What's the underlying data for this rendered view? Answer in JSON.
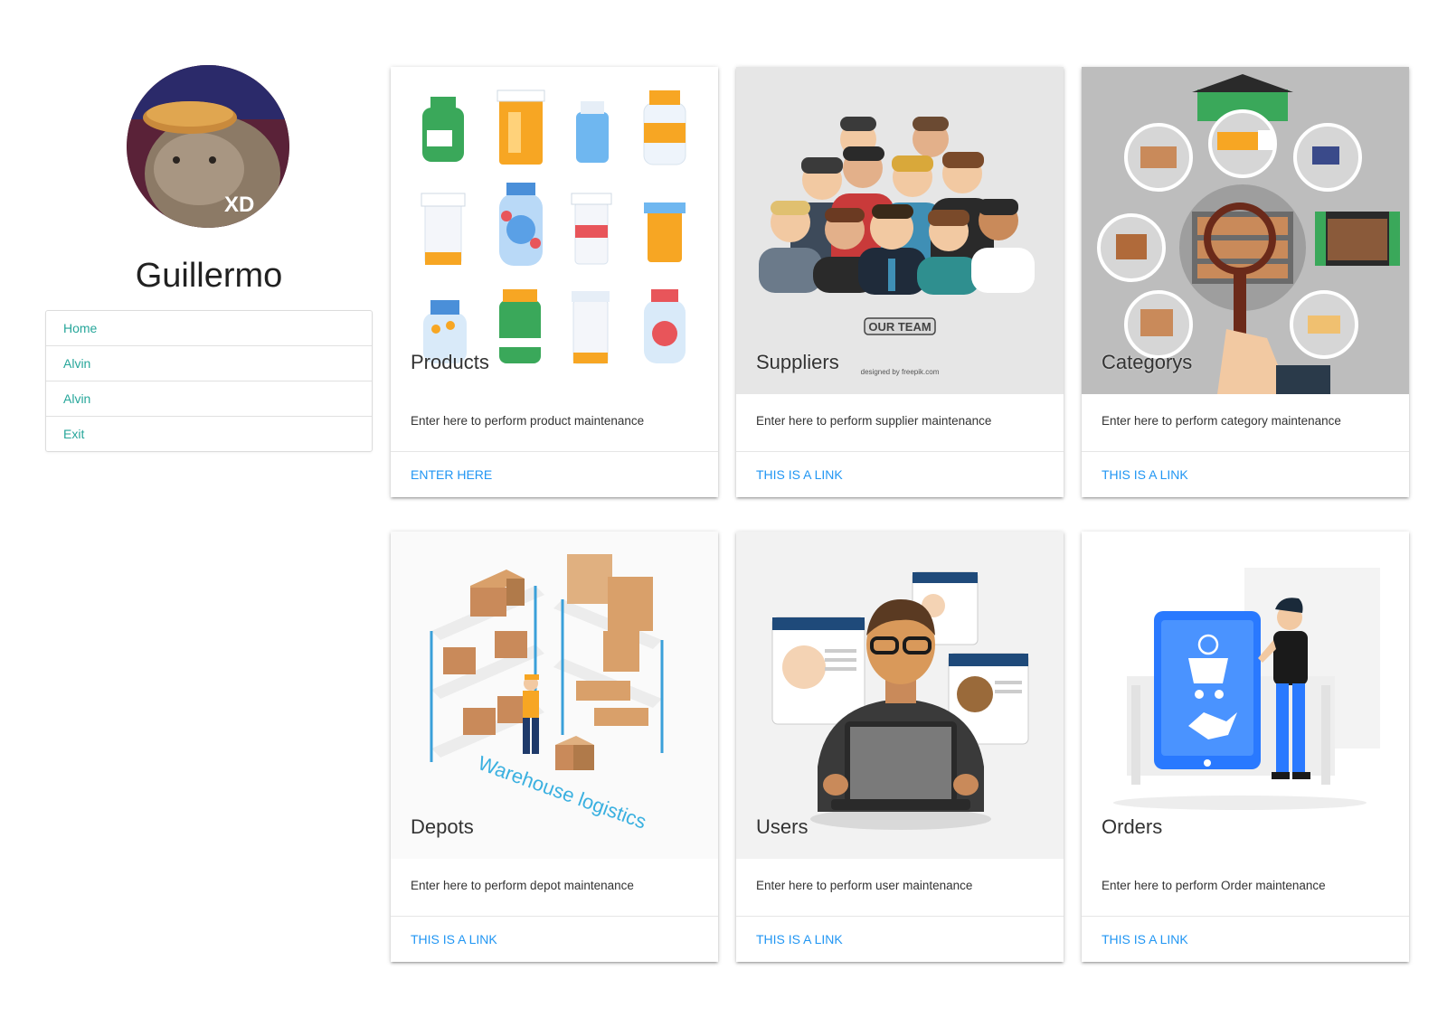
{
  "profile": {
    "name": "Guillermo",
    "avatar_badge": "XD"
  },
  "menu": {
    "items": [
      {
        "label": "Home"
      },
      {
        "label": "Alvin"
      },
      {
        "label": "Alvin"
      },
      {
        "label": "Exit"
      }
    ]
  },
  "cards": [
    {
      "title": "Products",
      "description": "Enter here to perform product maintenance",
      "link": "ENTER HERE"
    },
    {
      "title": "Suppliers",
      "description": "Enter here to perform supplier maintenance",
      "link": "THIS IS A LINK",
      "image_text": "OUR TEAM",
      "credit": "designed by freepik.com"
    },
    {
      "title": "Categorys",
      "description": "Enter here to perform category maintenance",
      "link": "THIS IS A LINK"
    },
    {
      "title": "Depots",
      "description": "Enter here to perform depot maintenance",
      "link": "THIS IS A LINK",
      "image_text": "Warehouse logistics"
    },
    {
      "title": "Users",
      "description": "Enter here to perform user maintenance",
      "link": "THIS IS A LINK"
    },
    {
      "title": "Orders",
      "description": "Enter here to perform Order maintenance",
      "link": "THIS IS A LINK"
    }
  ],
  "colors": {
    "menu_link": "#26a69a",
    "card_link": "#2196f3"
  }
}
